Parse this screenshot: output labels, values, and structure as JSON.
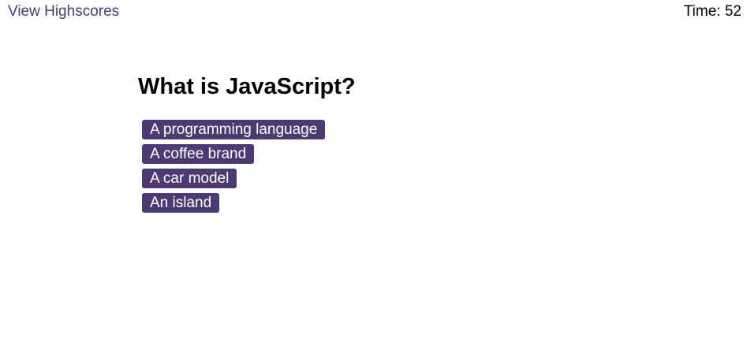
{
  "header": {
    "highscores_label": "View Highscores",
    "timer_text": "Time: 52"
  },
  "question": {
    "title": "What is JavaScript?",
    "answers": [
      "A programming language",
      "A coffee brand",
      "A car model",
      "An island"
    ]
  },
  "colors": {
    "accent": "#4d3a72",
    "button_text": "#ffffff",
    "background": "#ffffff"
  }
}
